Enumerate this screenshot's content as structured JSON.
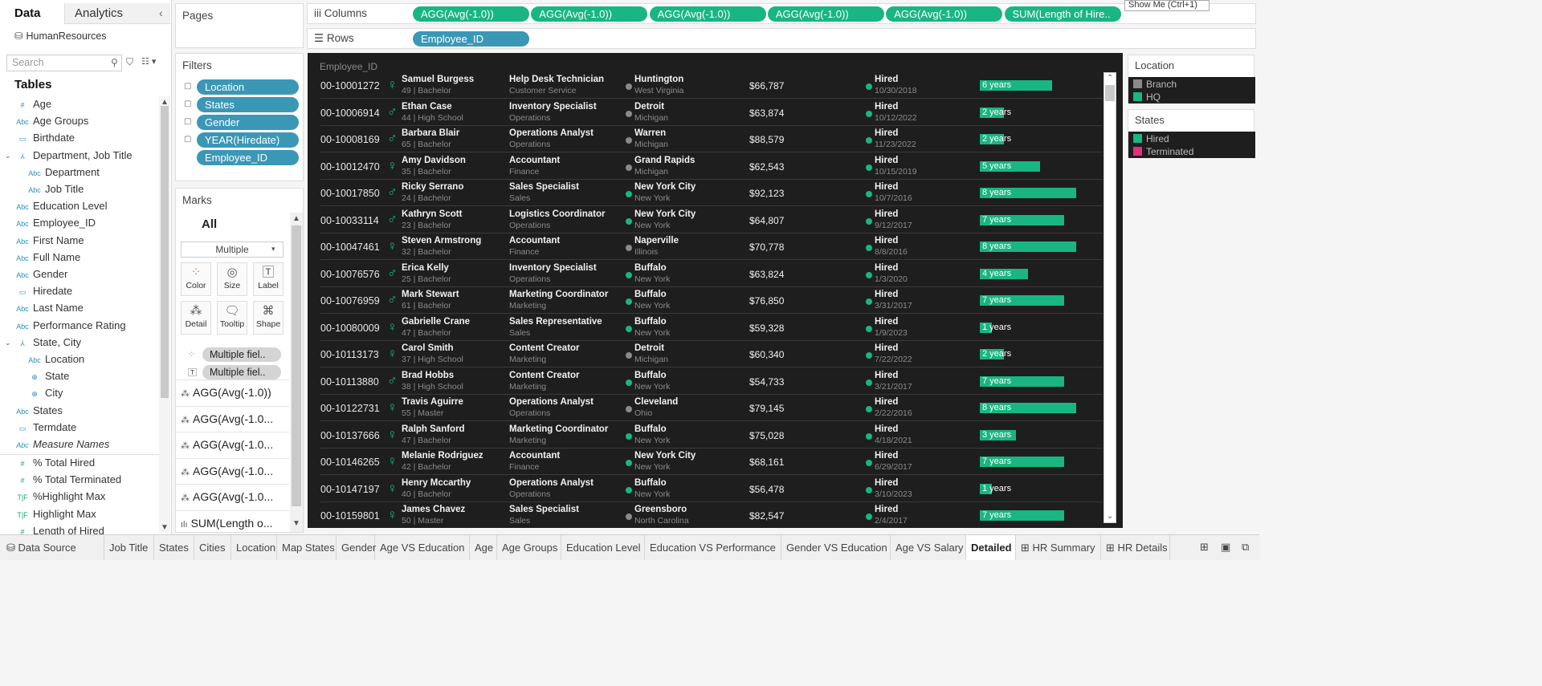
{
  "data_pane": {
    "tab_data": "Data",
    "tab_analytics": "Analytics",
    "datasource": "HumanResources",
    "search_placeholder": "Search",
    "tables_heading": "Tables",
    "fields": [
      {
        "label": "Age",
        "type": "#"
      },
      {
        "label": "Age Groups",
        "type": "Abc"
      },
      {
        "label": "Birthdate",
        "type": "date"
      },
      {
        "label": "Department, Job Title",
        "type": "hier"
      },
      {
        "label": "Department",
        "type": "Abc"
      },
      {
        "label": "Job Title",
        "type": "Abc"
      },
      {
        "label": "Education Level",
        "type": "Abc"
      },
      {
        "label": "Employee_ID",
        "type": "Abc"
      },
      {
        "label": "First Name",
        "type": "Abc"
      },
      {
        "label": "Full Name",
        "type": "Abc"
      },
      {
        "label": "Gender",
        "type": "Abc"
      },
      {
        "label": "Hiredate",
        "type": "date"
      },
      {
        "label": "Last Name",
        "type": "Abc"
      },
      {
        "label": "Performance Rating",
        "type": "Abc"
      },
      {
        "label": "State, City",
        "type": "hier"
      },
      {
        "label": "Location",
        "type": "Abc"
      },
      {
        "label": "State",
        "type": "geo"
      },
      {
        "label": "City",
        "type": "geo"
      },
      {
        "label": "States",
        "type": "Abc"
      },
      {
        "label": "Termdate",
        "type": "date"
      },
      {
        "label": "Measure Names",
        "type": "Abc"
      }
    ],
    "measures": [
      {
        "label": "% Total Hired",
        "type": "#"
      },
      {
        "label": "% Total Terminated",
        "type": "#"
      },
      {
        "label": "%Highlight Max",
        "type": "T|F"
      },
      {
        "label": "Highlight Max",
        "type": "T|F"
      },
      {
        "label": "Length of Hired",
        "type": "#"
      }
    ]
  },
  "pages": {
    "title": "Pages"
  },
  "filters": {
    "title": "Filters",
    "items": [
      "Location",
      "States",
      "Gender",
      "YEAR(Hiredate)",
      "Employee_ID"
    ]
  },
  "marks": {
    "title": "Marks",
    "all": "All",
    "mark_type": "Multiple",
    "buttons": [
      "Color",
      "Size",
      "Label",
      "Detail",
      "Tooltip",
      "Shape"
    ],
    "fields": [
      "Multiple fiel..",
      "Multiple fiel.."
    ],
    "cards": [
      "AGG(Avg(-1.0))",
      "AGG(Avg(-1.0...",
      "AGG(Avg(-1.0...",
      "AGG(Avg(-1.0...",
      "AGG(Avg(-1.0...",
      "SUM(Length o..."
    ]
  },
  "shelves": {
    "columns_label": "Columns",
    "rows_label": "Rows",
    "columns": [
      "AGG(Avg(-1.0))",
      "AGG(Avg(-1.0))",
      "AGG(Avg(-1.0))",
      "AGG(Avg(-1.0))",
      "AGG(Avg(-1.0))",
      "SUM(Length of Hire.."
    ],
    "rows": [
      "Employee_ID"
    ],
    "show_me": "Show Me (Ctrl+1)"
  },
  "view": {
    "header": "Employee_ID",
    "employees": [
      {
        "id": "00-10001272",
        "name": "Samuel Burgess",
        "age": "49",
        "edu": "Bachelor",
        "gender": "female",
        "job": "Help Desk Technician",
        "dept": "Customer Service",
        "city": "Huntington",
        "state": "West Virginia",
        "loc": "Branch",
        "salary": "$66,787",
        "status": "Hired",
        "date": "10/30/2018",
        "years": 6,
        "years_label": "6 years"
      },
      {
        "id": "00-10006914",
        "name": "Ethan Case",
        "age": "44",
        "edu": "High School",
        "gender": "male",
        "job": "Inventory Specialist",
        "dept": "Operations",
        "city": "Detroit",
        "state": "Michigan",
        "loc": "Branch",
        "salary": "$63,874",
        "status": "Hired",
        "date": "10/12/2022",
        "years": 2,
        "years_label": "2 years"
      },
      {
        "id": "00-10008169",
        "name": "Barbara Blair",
        "age": "65",
        "edu": "Bachelor",
        "gender": "male",
        "job": "Operations Analyst",
        "dept": "Operations",
        "city": "Warren",
        "state": "Michigan",
        "loc": "Branch",
        "salary": "$88,579",
        "status": "Hired",
        "date": "11/23/2022",
        "years": 2,
        "years_label": "2 years"
      },
      {
        "id": "00-10012470",
        "name": "Amy Davidson",
        "age": "35",
        "edu": "Bachelor",
        "gender": "female",
        "job": "Accountant",
        "dept": "Finance",
        "city": "Grand Rapids",
        "state": "Michigan",
        "loc": "Branch",
        "salary": "$62,543",
        "status": "Hired",
        "date": "10/15/2019",
        "years": 5,
        "years_label": "5 years"
      },
      {
        "id": "00-10017850",
        "name": "Ricky Serrano",
        "age": "24",
        "edu": "Bachelor",
        "gender": "male",
        "job": "Sales Specialist",
        "dept": "Sales",
        "city": "New York City",
        "state": "New York",
        "loc": "HQ",
        "salary": "$92,123",
        "status": "Hired",
        "date": "10/7/2016",
        "years": 8,
        "years_label": "8 years"
      },
      {
        "id": "00-10033114",
        "name": "Kathryn Scott",
        "age": "23",
        "edu": "Bachelor",
        "gender": "male",
        "job": "Logistics Coordinator",
        "dept": "Operations",
        "city": "New York City",
        "state": "New York",
        "loc": "HQ",
        "salary": "$64,807",
        "status": "Hired",
        "date": "9/12/2017",
        "years": 7,
        "years_label": "7 years"
      },
      {
        "id": "00-10047461",
        "name": "Steven Armstrong",
        "age": "32",
        "edu": "Bachelor",
        "gender": "female",
        "job": "Accountant",
        "dept": "Finance",
        "city": "Naperville",
        "state": "Illinois",
        "loc": "Branch",
        "salary": "$70,778",
        "status": "Hired",
        "date": "8/8/2016",
        "years": 8,
        "years_label": "8 years"
      },
      {
        "id": "00-10076576",
        "name": "Erica Kelly",
        "age": "25",
        "edu": "Bachelor",
        "gender": "male",
        "job": "Inventory Specialist",
        "dept": "Operations",
        "city": "Buffalo",
        "state": "New York",
        "loc": "HQ",
        "salary": "$63,824",
        "status": "Hired",
        "date": "1/3/2020",
        "years": 4,
        "years_label": "4 years"
      },
      {
        "id": "00-10076959",
        "name": "Mark Stewart",
        "age": "61",
        "edu": "Bachelor",
        "gender": "male",
        "job": "Marketing Coordinator",
        "dept": "Marketing",
        "city": "Buffalo",
        "state": "New York",
        "loc": "HQ",
        "salary": "$76,850",
        "status": "Hired",
        "date": "3/31/2017",
        "years": 7,
        "years_label": "7 years"
      },
      {
        "id": "00-10080009",
        "name": "Gabrielle Crane",
        "age": "47",
        "edu": "Bachelor",
        "gender": "female",
        "job": "Sales Representative",
        "dept": "Sales",
        "city": "Buffalo",
        "state": "New York",
        "loc": "HQ",
        "salary": "$59,328",
        "status": "Hired",
        "date": "1/9/2023",
        "years": 1,
        "years_label": "1 years"
      },
      {
        "id": "00-10113173",
        "name": "Carol Smith",
        "age": "37",
        "edu": "High School",
        "gender": "female",
        "job": "Content Creator",
        "dept": "Marketing",
        "city": "Detroit",
        "state": "Michigan",
        "loc": "Branch",
        "salary": "$60,340",
        "status": "Hired",
        "date": "7/22/2022",
        "years": 2,
        "years_label": "2 years"
      },
      {
        "id": "00-10113880",
        "name": "Brad Hobbs",
        "age": "38",
        "edu": "High School",
        "gender": "male",
        "job": "Content Creator",
        "dept": "Marketing",
        "city": "Buffalo",
        "state": "New York",
        "loc": "HQ",
        "salary": "$54,733",
        "status": "Hired",
        "date": "3/21/2017",
        "years": 7,
        "years_label": "7 years"
      },
      {
        "id": "00-10122731",
        "name": "Travis Aguirre",
        "age": "55",
        "edu": "Master",
        "gender": "female",
        "job": "Operations Analyst",
        "dept": "Operations",
        "city": "Cleveland",
        "state": "Ohio",
        "loc": "Branch",
        "salary": "$79,145",
        "status": "Hired",
        "date": "2/22/2016",
        "years": 8,
        "years_label": "8 years"
      },
      {
        "id": "00-10137666",
        "name": "Ralph Sanford",
        "age": "47",
        "edu": "Bachelor",
        "gender": "female",
        "job": "Marketing Coordinator",
        "dept": "Marketing",
        "city": "Buffalo",
        "state": "New York",
        "loc": "HQ",
        "salary": "$75,028",
        "status": "Hired",
        "date": "4/18/2021",
        "years": 3,
        "years_label": "3 years"
      },
      {
        "id": "00-10146265",
        "name": "Melanie Rodriguez",
        "age": "42",
        "edu": "Bachelor",
        "gender": "female",
        "job": "Accountant",
        "dept": "Finance",
        "city": "New York City",
        "state": "New York",
        "loc": "HQ",
        "salary": "$68,161",
        "status": "Hired",
        "date": "6/29/2017",
        "years": 7,
        "years_label": "7 years"
      },
      {
        "id": "00-10147197",
        "name": "Henry Mccarthy",
        "age": "40",
        "edu": "Bachelor",
        "gender": "female",
        "job": "Operations Analyst",
        "dept": "Operations",
        "city": "Buffalo",
        "state": "New York",
        "loc": "HQ",
        "salary": "$56,478",
        "status": "Hired",
        "date": "3/10/2023",
        "years": 1,
        "years_label": "1 years"
      },
      {
        "id": "00-10159801",
        "name": "James Chavez",
        "age": "50",
        "edu": "Master",
        "gender": "female",
        "job": "Sales Specialist",
        "dept": "Sales",
        "city": "Greensboro",
        "state": "North Carolina",
        "loc": "Branch",
        "salary": "$82,547",
        "status": "Hired",
        "date": "2/4/2017",
        "years": 7,
        "years_label": "7 years"
      }
    ]
  },
  "legends": {
    "location_title": "Location",
    "location_items": [
      {
        "label": "Branch",
        "color": "#8a8a8a"
      },
      {
        "label": "HQ",
        "color": "#19b583"
      }
    ],
    "states_title": "States",
    "states_items": [
      {
        "label": "Hired",
        "color": "#19b583"
      },
      {
        "label": "Terminated",
        "color": "#e0307a"
      }
    ]
  },
  "colors": {
    "accent": "#19b583",
    "pill_blue": "#3b97b6",
    "view_bg": "#1e1e1e",
    "branch": "#8a8a8a"
  },
  "tabs": {
    "data_source": "Data Source",
    "sheets": [
      "Job Title",
      "States",
      "Cities",
      "Location",
      "Map States",
      "Gender",
      "Age VS Education",
      "Age",
      "Age Groups",
      "Education Level",
      "Education VS Performance",
      "Gender VS Education",
      "Age VS Salary",
      "Detailed",
      "HR Summary",
      "HR Details"
    ],
    "active": "Detailed"
  }
}
